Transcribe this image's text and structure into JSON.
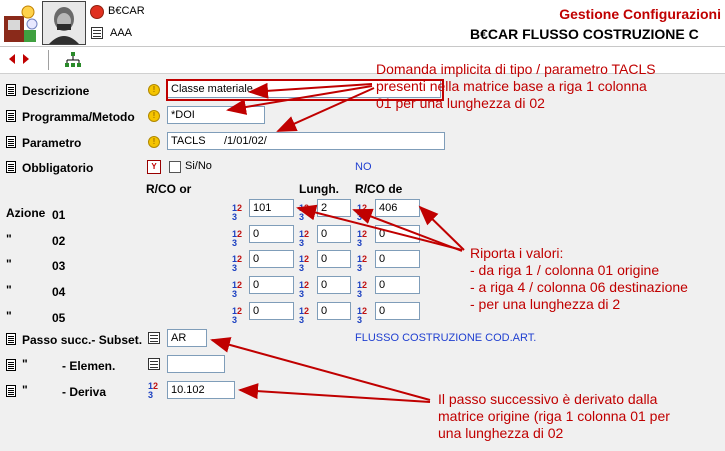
{
  "header": {
    "logo_code": "B€CAR",
    "subcode": "AAA",
    "app_title": "Gestione Configurazioni",
    "subtitle": "B€CAR FLUSSO COSTRUZIONE C"
  },
  "toolbar": {
    "prev": "◀",
    "next": "▶"
  },
  "form": {
    "descrizione": {
      "label": "Descrizione",
      "value": "Classe materiale"
    },
    "programma": {
      "label": "Programma/Metodo",
      "value": "*DOI"
    },
    "parametro": {
      "label": "Parametro",
      "value": "TACLS      /1/01/02/"
    },
    "obbligatorio": {
      "label": "Obbligatorio",
      "checkbox_label": "Si/No",
      "value": "NO"
    },
    "columns": {
      "rco_or": "R/CO or",
      "lungh": "Lungh.",
      "rco_de": "R/CO de"
    },
    "azioni": [
      {
        "label": "Azione",
        "num": "01",
        "or": "101",
        "lungh": "2",
        "de": "406"
      },
      {
        "label": "\"",
        "num": "02",
        "or": "0",
        "lungh": "0",
        "de": "0"
      },
      {
        "label": "\"",
        "num": "03",
        "or": "0",
        "lungh": "0",
        "de": "0"
      },
      {
        "label": "\"",
        "num": "04",
        "or": "0",
        "lungh": "0",
        "de": "0"
      },
      {
        "label": "\"",
        "num": "05",
        "or": "0",
        "lungh": "0",
        "de": "0"
      }
    ],
    "passo": {
      "label": "Passo succ.- Subset.",
      "value": "AR",
      "description": "FLUSSO COSTRUZIONE COD.ART."
    },
    "elemen": {
      "label_quote": "\"",
      "label": "- Elemen.",
      "value": ""
    },
    "deriva": {
      "label_quote": "\"",
      "label": "- Deriva",
      "value": "10.102"
    }
  },
  "annotations": {
    "note1": [
      "Domanda implicita di tipo / parametro TACLS",
      "presenti nella matrice base a riga 1 colonna",
      "01 per una lunghezza di 02"
    ],
    "note2": [
      "Riporta i valori:",
      "- da riga 1 / colonna 01 origine",
      "- a riga 4 / colonna 06 destinazione",
      "- per una lunghezza di 2"
    ],
    "note3": [
      "Il passo successivo è derivato dalla",
      "matrice origine (riga 1 colonna 01 per",
      "una lunghezza di 02"
    ]
  },
  "icons": {
    "label_doc": "document-icon",
    "bulb": "lightbulb-icon",
    "number_format": "number-format-icon",
    "table": "table-icon"
  },
  "colors": {
    "accent_red": "#c00000",
    "blue_text": "#1f3fd0",
    "arrow": "#c00000"
  }
}
